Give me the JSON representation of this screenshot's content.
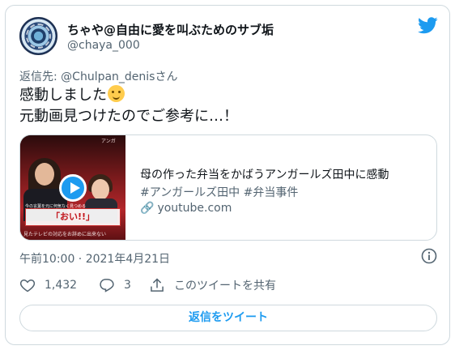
{
  "tweet": {
    "author": {
      "display_name": "ちゃや@自由に愛を叫ぶためのサブ垢",
      "handle": "@chaya_000"
    },
    "reply_to": "返信先: @Chulpan_denisさん",
    "text_line1": "感動しました",
    "text_line2": "元動画見つけたのでご参考に…！",
    "emoji": "smiling-face-with-tear",
    "timestamp": "午前10:00 · 2021年4月21日"
  },
  "link_card": {
    "title": "母の作った弁当をかばうアンガールズ田中に感動",
    "description": "#アンガールズ田中 #弁当事件",
    "domain": "youtube.com",
    "thumbnail": {
      "caption": "「おい!!」",
      "top_caption": "今の言葉を元に何気なく見つめる",
      "sub_caption": "見たテレビの対応をお辞めに出来ない",
      "corner_text": "アンガ"
    }
  },
  "actions": {
    "like_count": "1,432",
    "reply_count": "3",
    "share_label": "このツイートを共有",
    "reply_button_label": "返信をツイート"
  },
  "colors": {
    "accent": "#1d9bf0",
    "text_primary": "#0f1419",
    "text_secondary": "#536471",
    "border": "#cfd9de"
  }
}
